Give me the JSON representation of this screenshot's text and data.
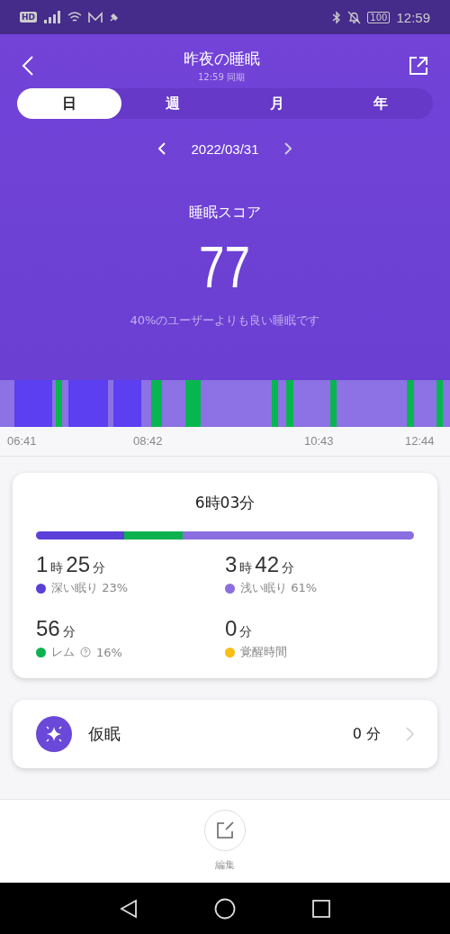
{
  "status_bar": {
    "badge": "HD",
    "time": "12:59",
    "battery": "100"
  },
  "header": {
    "title": "昨夜の睡眠",
    "subtitle": "12:59 同期"
  },
  "tabs": [
    {
      "label": "日",
      "selected": true
    },
    {
      "label": "週",
      "selected": false
    },
    {
      "label": "月",
      "selected": false
    },
    {
      "label": "年",
      "selected": false
    }
  ],
  "date": "2022/03/31",
  "score": {
    "label": "睡眠スコア",
    "value": "77",
    "comparison": "40%のユーザーよりも良い睡眠です"
  },
  "timeline": {
    "times": [
      "06:41",
      "08:42",
      "10:43",
      "12:44"
    ]
  },
  "summary": {
    "total": "6時03分",
    "stages": [
      {
        "kind": "deep",
        "parts": [
          [
            "1",
            "時"
          ],
          [
            "25",
            "分"
          ]
        ],
        "label": "深い眠り 23%",
        "color": "#5b3fd8"
      },
      {
        "kind": "light",
        "parts": [
          [
            "3",
            "時"
          ],
          [
            "42",
            "分"
          ]
        ],
        "label": "浅い眠り 61%",
        "color": "#8b6ee0"
      },
      {
        "kind": "rem",
        "parts": [
          [
            "56",
            "分"
          ]
        ],
        "label": "レム",
        "percent": "16%",
        "color": "#0db24f"
      },
      {
        "kind": "awake",
        "parts": [
          [
            "0",
            "分"
          ]
        ],
        "label": "覚醒時間",
        "color": "#f8be12"
      }
    ]
  },
  "nap": {
    "label": "仮眠",
    "value": "0 分"
  },
  "edit": {
    "label": "編集"
  }
}
